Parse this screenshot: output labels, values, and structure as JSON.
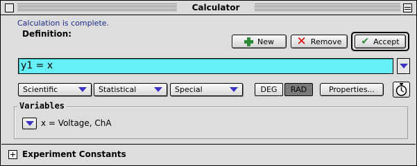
{
  "window": {
    "title": "Calculator"
  },
  "status": {
    "text": "Calculation is complete."
  },
  "definition": {
    "label": "Definition:",
    "value": "y1 = x",
    "dropdown_icon": "triangle-down-icon"
  },
  "toolbar": {
    "new_label": "New",
    "remove_label": "Remove",
    "accept_label": "Accept",
    "new_icon": "plus-icon",
    "remove_icon": "x-icon",
    "accept_icon": "check-icon"
  },
  "functions": {
    "scientific_label": "Scientific",
    "statistical_label": "Statistical",
    "special_label": "Special",
    "angle_options": [
      "DEG",
      "RAD"
    ],
    "angle_selected": "RAD",
    "properties_label": "Properties...",
    "timer_icon": "stopwatch-icon"
  },
  "variables": {
    "label": "Variables",
    "items": [
      {
        "text": "x = Voltage, ChA"
      }
    ]
  },
  "experiment_constants": {
    "label": "Experiment Constants",
    "icon": "plus-box-icon"
  },
  "colors": {
    "definition_field": "#66f0f8",
    "status_text": "#1a2a8a",
    "accent_popup_arrow": "#3a35c4",
    "plus_green": "#2e8b3a",
    "remove_red": "#e00000"
  }
}
